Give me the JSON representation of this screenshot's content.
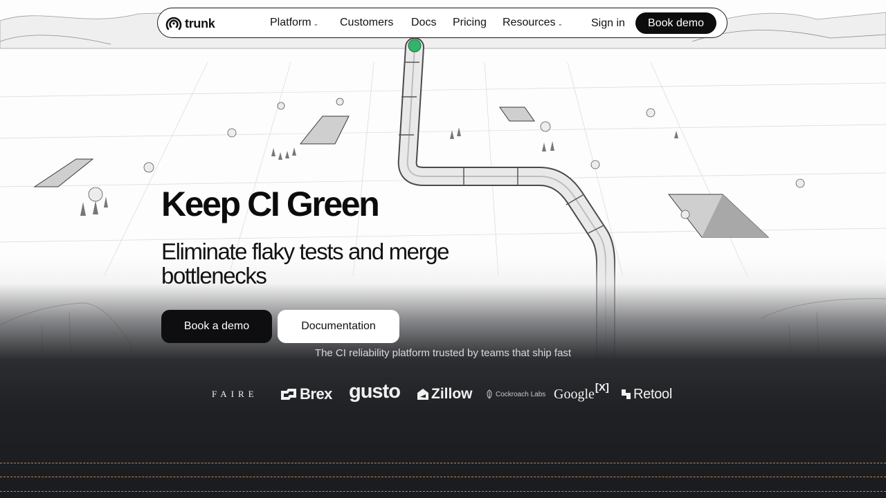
{
  "nav": {
    "logo_text": "trunk",
    "items": [
      {
        "label": "Platform",
        "has_caret": true
      },
      {
        "label": "Customers",
        "has_caret": false
      },
      {
        "label": "Docs",
        "has_caret": false
      },
      {
        "label": "Pricing",
        "has_caret": false
      },
      {
        "label": "Resources",
        "has_caret": true
      }
    ],
    "sign_in": "Sign in",
    "book_demo": "Book demo"
  },
  "hero": {
    "title": "Keep CI Green",
    "subtitle": "Eliminate flaky tests and merge bottlenecks",
    "primary_cta": "Book a demo",
    "secondary_cta": "Documentation",
    "trusted_text": "The CI reliability platform trusted by teams that ship fast"
  },
  "customers": {
    "faire": "FAIRE",
    "brex": "Brex",
    "gusto": "gusto",
    "zillow": "Zillow",
    "cockroach": "Cockroach Labs",
    "google": "Google",
    "google_suffix": "[X]",
    "retool": "Retool"
  },
  "colors": {
    "primary": "#0e0e10",
    "background_dark": "#1f2023",
    "accent_dash": "#d9925a",
    "status_dot": "#34b36a"
  },
  "icons": {
    "logo": "trunk-rings-icon",
    "caret": "chevron-down-icon"
  }
}
